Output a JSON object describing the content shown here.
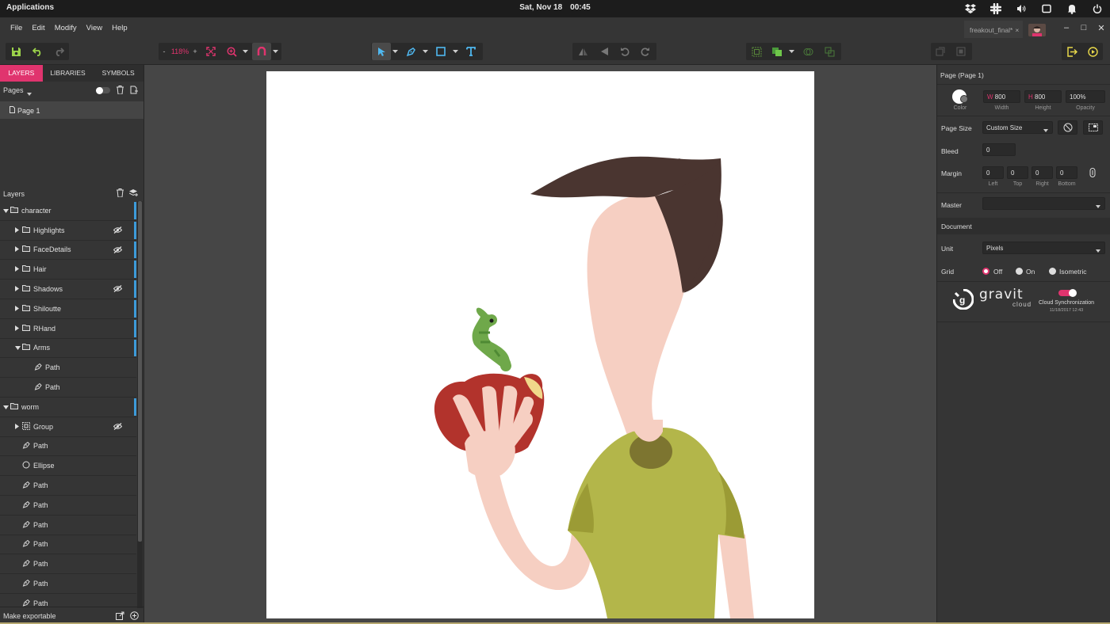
{
  "system": {
    "apps_label": "Applications",
    "date": "Sat, Nov 18",
    "time": "00:45",
    "tray_icons": [
      "dropbox-icon",
      "slack-icon",
      "volume-icon",
      "display-icon",
      "notification-icon",
      "power-icon"
    ]
  },
  "menu": {
    "items": [
      "File",
      "Edit",
      "Modify",
      "View",
      "Help"
    ]
  },
  "document_tab": {
    "title": "freakout_final*",
    "close": "×"
  },
  "window_controls": {
    "minimize": "–",
    "maximize": "□",
    "close": "✕"
  },
  "toolbar": {
    "zoom_minus": "-",
    "zoom_value": "118%",
    "zoom_plus": "+"
  },
  "left_panel": {
    "tabs": [
      "LAYERS",
      "LIBRARIES",
      "SYMBOLS"
    ],
    "pages_label": "Pages",
    "pages": [
      "Page 1"
    ],
    "layers_label": "Layers",
    "footer_label": "Make exportable",
    "layers": [
      {
        "name": "character",
        "type": "folder",
        "depth": 0,
        "expanded": true,
        "hidden": false,
        "bar": true
      },
      {
        "name": "Highlights",
        "type": "folder",
        "depth": 1,
        "expanded": false,
        "hidden": true,
        "bar": true
      },
      {
        "name": "FaceDetails",
        "type": "folder",
        "depth": 1,
        "expanded": false,
        "hidden": true,
        "bar": true
      },
      {
        "name": "Hair",
        "type": "folder",
        "depth": 1,
        "expanded": false,
        "hidden": false,
        "bar": true
      },
      {
        "name": "Shadows",
        "type": "folder",
        "depth": 1,
        "expanded": false,
        "hidden": true,
        "bar": true
      },
      {
        "name": "Shiloutte",
        "type": "folder",
        "depth": 1,
        "expanded": false,
        "hidden": false,
        "bar": true
      },
      {
        "name": "RHand",
        "type": "folder",
        "depth": 1,
        "expanded": false,
        "hidden": false,
        "bar": true
      },
      {
        "name": "Arms",
        "type": "folder",
        "depth": 1,
        "expanded": true,
        "hidden": false,
        "bar": true
      },
      {
        "name": "Path",
        "type": "path",
        "depth": 2,
        "hidden": false,
        "bar": false
      },
      {
        "name": "Path",
        "type": "path",
        "depth": 2,
        "hidden": false,
        "bar": false
      },
      {
        "name": "worm",
        "type": "folder",
        "depth": 0,
        "expanded": true,
        "hidden": false,
        "bar": true
      },
      {
        "name": "Group",
        "type": "group",
        "depth": 1,
        "expanded": false,
        "hidden": true,
        "bar": false
      },
      {
        "name": "Path",
        "type": "path",
        "depth": 1,
        "hidden": false,
        "bar": false
      },
      {
        "name": "Ellipse",
        "type": "ellipse",
        "depth": 1,
        "hidden": false,
        "bar": false
      },
      {
        "name": "Path",
        "type": "path",
        "depth": 1,
        "hidden": false,
        "bar": false
      },
      {
        "name": "Path",
        "type": "path",
        "depth": 1,
        "hidden": false,
        "bar": false
      },
      {
        "name": "Path",
        "type": "path",
        "depth": 1,
        "hidden": false,
        "bar": false
      },
      {
        "name": "Path",
        "type": "path",
        "depth": 1,
        "hidden": false,
        "bar": false
      },
      {
        "name": "Path",
        "type": "path",
        "depth": 1,
        "hidden": false,
        "bar": false
      },
      {
        "name": "Path",
        "type": "path",
        "depth": 1,
        "hidden": false,
        "bar": false
      },
      {
        "name": "Path",
        "type": "path",
        "depth": 1,
        "hidden": false,
        "bar": false
      }
    ]
  },
  "right_panel": {
    "title": "Page (Page 1)",
    "color_label": "Color",
    "width_prefix": "W",
    "width_value": "800",
    "width_label": "Width",
    "height_prefix": "H",
    "height_value": "800",
    "height_label": "Height",
    "opacity_value": "100%",
    "opacity_label": "Opacity",
    "page_size_label": "Page Size",
    "page_size_value": "Custom Size",
    "bleed_label": "Bleed",
    "bleed_value": "0",
    "margin_label": "Margin",
    "margin_values": [
      "0",
      "0",
      "0",
      "0"
    ],
    "margin_sub": [
      "Left",
      "Top",
      "Right",
      "Bottom"
    ],
    "master_label": "Master",
    "master_value": "",
    "document_label": "Document",
    "unit_label": "Unit",
    "unit_value": "Pixels",
    "grid_label": "Grid",
    "grid_options": [
      "Off",
      "On",
      "Isometric"
    ],
    "grid_selected": "Off",
    "cloud_brand": "gravit",
    "cloud_brand_sub": "cloud",
    "cloud_sync_label": "Cloud Synchronization",
    "cloud_sync_date": "11/18/2017 12:43",
    "cloud_sync_enabled": true
  },
  "colors": {
    "accent": "#e0346e",
    "selection_blue": "#3d9bd9",
    "hair": "#4a3530",
    "skin": "#f6cfc2",
    "shirt": "#b3b64a",
    "apple": "#b2332c",
    "worm": "#6fa84a"
  }
}
